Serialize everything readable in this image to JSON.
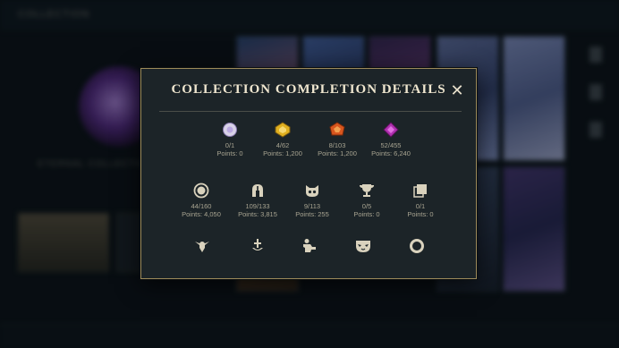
{
  "background": {
    "breadcrumb": "COLLECTION",
    "left_title": "ETERNAL COLLECTION"
  },
  "modal": {
    "title": "COLLECTION COMPLETION DETAILS",
    "close_label": "✕"
  },
  "rarity_row": [
    {
      "icon": "common-gem-icon",
      "count": "0/1",
      "points": "Points: 0"
    },
    {
      "icon": "epic-gem-icon",
      "count": "4/62",
      "points": "Points: 1,200"
    },
    {
      "icon": "legendary-gem-icon",
      "count": "8/103",
      "points": "Points: 1,200"
    },
    {
      "icon": "mythic-gem-icon",
      "count": "52/455",
      "points": "Points: 6,240"
    }
  ],
  "category_row": [
    {
      "icon": "icon-token-icon",
      "count": "44/160",
      "points": "Points: 4,050"
    },
    {
      "icon": "helmet-icon",
      "count": "109/133",
      "points": "Points: 3,815"
    },
    {
      "icon": "ward-icon",
      "count": "9/113",
      "points": "Points: 255"
    },
    {
      "icon": "trophy-icon",
      "count": "0/5",
      "points": "Points: 0"
    },
    {
      "icon": "stacked-cards-icon",
      "count": "0/1",
      "points": "Points: 0"
    }
  ],
  "bottom_icons": [
    "emote-icon",
    "sword-icon",
    "figure-icon",
    "mask-icon",
    "ring-icon"
  ],
  "colors": {
    "modal_bg": "#1c2428",
    "modal_border": "#9c8a5a",
    "title_text": "#efe6cf",
    "stat_text": "#a8a491",
    "icon_fill": "#d9d2bd"
  }
}
